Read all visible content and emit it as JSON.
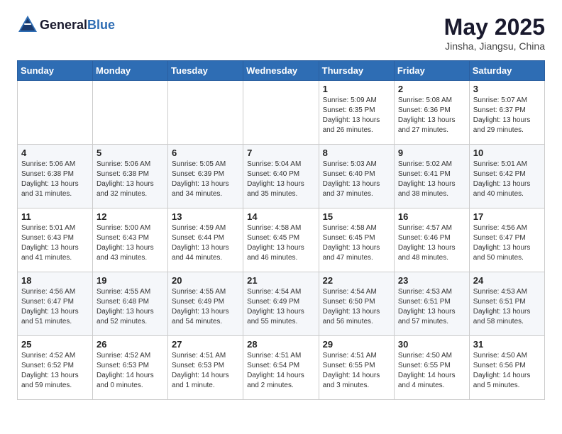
{
  "header": {
    "logo_general": "General",
    "logo_blue": "Blue",
    "title": "May 2025",
    "location": "Jinsha, Jiangsu, China"
  },
  "days_of_week": [
    "Sunday",
    "Monday",
    "Tuesday",
    "Wednesday",
    "Thursday",
    "Friday",
    "Saturday"
  ],
  "weeks": [
    [
      {
        "day": "",
        "info": ""
      },
      {
        "day": "",
        "info": ""
      },
      {
        "day": "",
        "info": ""
      },
      {
        "day": "",
        "info": ""
      },
      {
        "day": "1",
        "info": "Sunrise: 5:09 AM\nSunset: 6:35 PM\nDaylight: 13 hours\nand 26 minutes."
      },
      {
        "day": "2",
        "info": "Sunrise: 5:08 AM\nSunset: 6:36 PM\nDaylight: 13 hours\nand 27 minutes."
      },
      {
        "day": "3",
        "info": "Sunrise: 5:07 AM\nSunset: 6:37 PM\nDaylight: 13 hours\nand 29 minutes."
      }
    ],
    [
      {
        "day": "4",
        "info": "Sunrise: 5:06 AM\nSunset: 6:38 PM\nDaylight: 13 hours\nand 31 minutes."
      },
      {
        "day": "5",
        "info": "Sunrise: 5:06 AM\nSunset: 6:38 PM\nDaylight: 13 hours\nand 32 minutes."
      },
      {
        "day": "6",
        "info": "Sunrise: 5:05 AM\nSunset: 6:39 PM\nDaylight: 13 hours\nand 34 minutes."
      },
      {
        "day": "7",
        "info": "Sunrise: 5:04 AM\nSunset: 6:40 PM\nDaylight: 13 hours\nand 35 minutes."
      },
      {
        "day": "8",
        "info": "Sunrise: 5:03 AM\nSunset: 6:40 PM\nDaylight: 13 hours\nand 37 minutes."
      },
      {
        "day": "9",
        "info": "Sunrise: 5:02 AM\nSunset: 6:41 PM\nDaylight: 13 hours\nand 38 minutes."
      },
      {
        "day": "10",
        "info": "Sunrise: 5:01 AM\nSunset: 6:42 PM\nDaylight: 13 hours\nand 40 minutes."
      }
    ],
    [
      {
        "day": "11",
        "info": "Sunrise: 5:01 AM\nSunset: 6:43 PM\nDaylight: 13 hours\nand 41 minutes."
      },
      {
        "day": "12",
        "info": "Sunrise: 5:00 AM\nSunset: 6:43 PM\nDaylight: 13 hours\nand 43 minutes."
      },
      {
        "day": "13",
        "info": "Sunrise: 4:59 AM\nSunset: 6:44 PM\nDaylight: 13 hours\nand 44 minutes."
      },
      {
        "day": "14",
        "info": "Sunrise: 4:58 AM\nSunset: 6:45 PM\nDaylight: 13 hours\nand 46 minutes."
      },
      {
        "day": "15",
        "info": "Sunrise: 4:58 AM\nSunset: 6:45 PM\nDaylight: 13 hours\nand 47 minutes."
      },
      {
        "day": "16",
        "info": "Sunrise: 4:57 AM\nSunset: 6:46 PM\nDaylight: 13 hours\nand 48 minutes."
      },
      {
        "day": "17",
        "info": "Sunrise: 4:56 AM\nSunset: 6:47 PM\nDaylight: 13 hours\nand 50 minutes."
      }
    ],
    [
      {
        "day": "18",
        "info": "Sunrise: 4:56 AM\nSunset: 6:47 PM\nDaylight: 13 hours\nand 51 minutes."
      },
      {
        "day": "19",
        "info": "Sunrise: 4:55 AM\nSunset: 6:48 PM\nDaylight: 13 hours\nand 52 minutes."
      },
      {
        "day": "20",
        "info": "Sunrise: 4:55 AM\nSunset: 6:49 PM\nDaylight: 13 hours\nand 54 minutes."
      },
      {
        "day": "21",
        "info": "Sunrise: 4:54 AM\nSunset: 6:49 PM\nDaylight: 13 hours\nand 55 minutes."
      },
      {
        "day": "22",
        "info": "Sunrise: 4:54 AM\nSunset: 6:50 PM\nDaylight: 13 hours\nand 56 minutes."
      },
      {
        "day": "23",
        "info": "Sunrise: 4:53 AM\nSunset: 6:51 PM\nDaylight: 13 hours\nand 57 minutes."
      },
      {
        "day": "24",
        "info": "Sunrise: 4:53 AM\nSunset: 6:51 PM\nDaylight: 13 hours\nand 58 minutes."
      }
    ],
    [
      {
        "day": "25",
        "info": "Sunrise: 4:52 AM\nSunset: 6:52 PM\nDaylight: 13 hours\nand 59 minutes."
      },
      {
        "day": "26",
        "info": "Sunrise: 4:52 AM\nSunset: 6:53 PM\nDaylight: 14 hours\nand 0 minutes."
      },
      {
        "day": "27",
        "info": "Sunrise: 4:51 AM\nSunset: 6:53 PM\nDaylight: 14 hours\nand 1 minute."
      },
      {
        "day": "28",
        "info": "Sunrise: 4:51 AM\nSunset: 6:54 PM\nDaylight: 14 hours\nand 2 minutes."
      },
      {
        "day": "29",
        "info": "Sunrise: 4:51 AM\nSunset: 6:55 PM\nDaylight: 14 hours\nand 3 minutes."
      },
      {
        "day": "30",
        "info": "Sunrise: 4:50 AM\nSunset: 6:55 PM\nDaylight: 14 hours\nand 4 minutes."
      },
      {
        "day": "31",
        "info": "Sunrise: 4:50 AM\nSunset: 6:56 PM\nDaylight: 14 hours\nand 5 minutes."
      }
    ]
  ]
}
